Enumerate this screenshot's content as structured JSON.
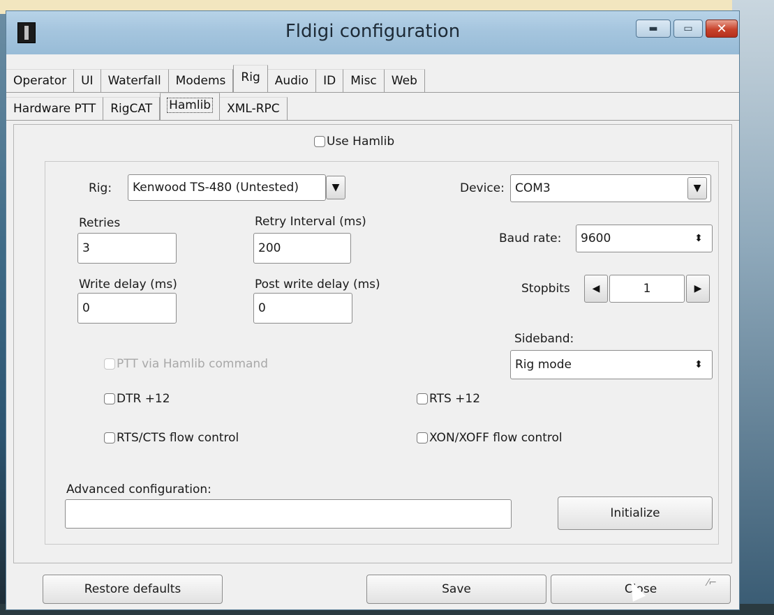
{
  "window": {
    "title": "Fldigi configuration",
    "min_icon": "minimize-icon",
    "max_icon": "maximize-icon",
    "close_icon": "close-icon"
  },
  "main_tabs": [
    "Operator",
    "UI",
    "Waterfall",
    "Modems",
    "Rig",
    "Audio",
    "ID",
    "Misc",
    "Web"
  ],
  "rig_tabs": [
    "Hardware PTT",
    "RigCAT",
    "Hamlib",
    "XML-RPC"
  ],
  "hamlib": {
    "use_hamlib": "Use Hamlib",
    "rig_label": "Rig:",
    "rig_value": "Kenwood TS-480  (Untested)",
    "device_label": "Device:",
    "device_value": "COM3",
    "retries_label": "Retries",
    "retries_value": "3",
    "retry_interval_label": "Retry Interval (ms)",
    "retry_interval_value": "200",
    "baud_label": "Baud rate:",
    "baud_value": "9600",
    "write_delay_label": "Write delay (ms)",
    "write_delay_value": "0",
    "post_write_delay_label": "Post write delay (ms)",
    "post_write_delay_value": "0",
    "stopbits_label": "Stopbits",
    "stopbits_value": "1",
    "sideband_label": "Sideband:",
    "sideband_value": "Rig mode",
    "ptt_via_hamlib": "PTT via Hamlib command",
    "dtr": "DTR +12",
    "rts": "RTS +12",
    "rts_cts": "RTS/CTS flow control",
    "xon_xoff": "XON/XOFF flow control",
    "advanced_label": "Advanced configuration:",
    "advanced_value": "",
    "initialize": "Initialize"
  },
  "footer": {
    "restore": "Restore defaults",
    "save": "Save",
    "close": "Close"
  }
}
